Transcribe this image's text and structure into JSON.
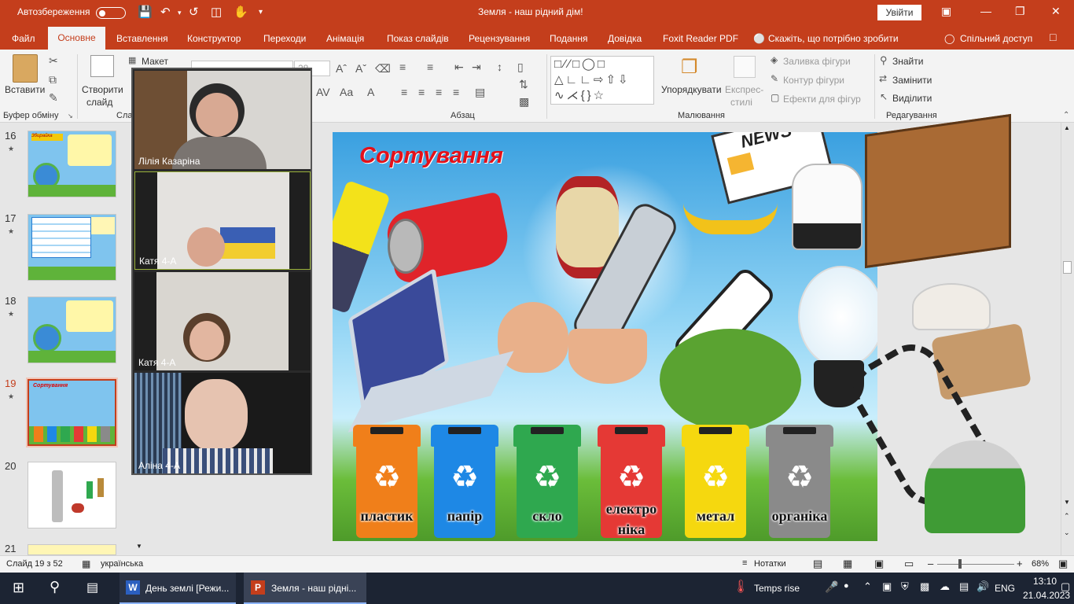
{
  "titlebar": {
    "autosave": "Автозбереження",
    "doc_title": "Земля - наш рідний дім!",
    "signin": "Увійти"
  },
  "menu": {
    "file": "Файл",
    "home": "Основне",
    "insert": "Вставлення",
    "design": "Конструктор",
    "transitions": "Переходи",
    "animations": "Анімація",
    "slideshow": "Показ слайдів",
    "review": "Рецензування",
    "view": "Подання",
    "help": "Довідка",
    "foxit": "Foxit Reader PDF",
    "tellme": "Скажіть, що потрібно зробити",
    "share": "Спільний доступ"
  },
  "ribbon": {
    "paste": "Вставити",
    "clipboard_group": "Буфер обміну",
    "new_slide_1": "Створити",
    "new_slide_2": "слайд",
    "layout": "Макет",
    "slides_group": "Сла",
    "paragraph_group": "Абзац",
    "shape_fill": "Заливка фігури",
    "shape_outline": "Контур фігури",
    "shape_effects": "Ефекти для фігур",
    "arrange": "Упорядкувати",
    "quick_styles_1": "Експрес-",
    "quick_styles_2": "стилі",
    "drawing_group": "Малювання",
    "find": "Знайти",
    "replace": "Замінити",
    "select": "Виділити",
    "editing_group": "Редагування",
    "font_size": "28"
  },
  "thumbnails": [
    {
      "num": "16",
      "title": "Збирайка"
    },
    {
      "num": "17",
      "title": ""
    },
    {
      "num": "18",
      "title": ""
    },
    {
      "num": "19",
      "title": "Сортування"
    },
    {
      "num": "20",
      "title": ""
    },
    {
      "num": "21",
      "title": ""
    }
  ],
  "video": {
    "p1": "Лілія Казаріна",
    "p2": "Катя  4-А",
    "p3": "Катя 4-А",
    "p4": "Аліна 4-А"
  },
  "slide": {
    "title": "Сортування",
    "news": "NEWS",
    "bins": [
      {
        "label": "пластик",
        "color": "#f07f1a"
      },
      {
        "label": "папір",
        "color": "#1e88e5"
      },
      {
        "label": "скло",
        "color": "#2fa84f"
      },
      {
        "label": "електро ніка",
        "color": "#e53935"
      },
      {
        "label": "метал",
        "color": "#f5d80f"
      },
      {
        "label": "органіка",
        "color": "#8a8a8a"
      }
    ]
  },
  "status": {
    "slide_of": "Слайд 19 з 52",
    "language": "українська",
    "notes": "Нотатки",
    "zoom": "68%"
  },
  "taskbar": {
    "word": "День землі [Режи...",
    "ppt": "Земля - наш рідні...",
    "weather": "Temps rise",
    "lang": "ENG",
    "time": "13:10",
    "date": "21.04.2023"
  }
}
